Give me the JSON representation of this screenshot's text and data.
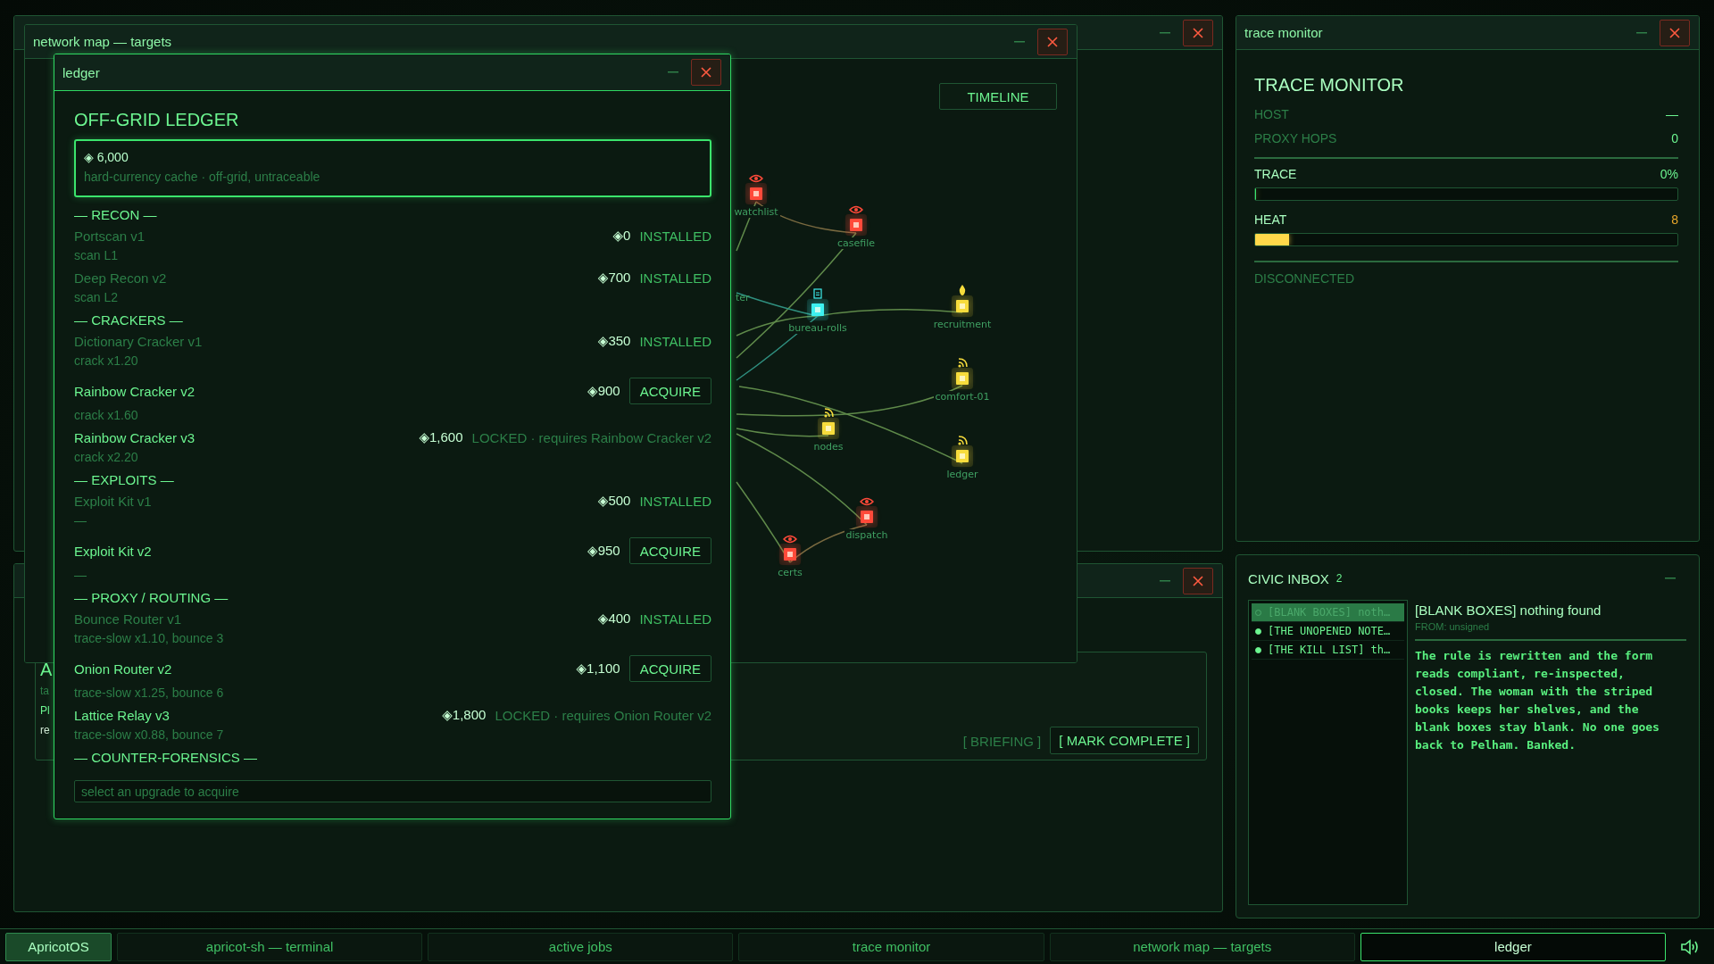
{
  "jobs_window": {
    "fragments": [
      "A",
      "ta",
      "Pl",
      "re"
    ],
    "actions": [
      {
        "label": "[ BRIEFING ]",
        "kind": "link"
      },
      {
        "label": "[ MARK COMPLETE ]",
        "kind": "button"
      }
    ]
  },
  "network_map": {
    "title": "network map — targets",
    "timeline_button": "TIMELINE",
    "cut_label": "ter",
    "nodes": [
      {
        "label": "watchlist",
        "kind": "watch",
        "color": "#ff4a3a"
      },
      {
        "label": "casefile",
        "kind": "watch",
        "color": "#ff4a3a"
      },
      {
        "label": "bureau-rolls",
        "kind": "file",
        "color": "#3ef0f0"
      },
      {
        "label": "recruitment",
        "kind": "flame",
        "color": "#f7dc3c"
      },
      {
        "label": "comfort-01",
        "kind": "signal",
        "color": "#f7dc3c"
      },
      {
        "label": "nodes",
        "kind": "signal",
        "color": "#f7dc3c"
      },
      {
        "label": "ledger",
        "kind": "signal",
        "color": "#f7dc3c"
      },
      {
        "label": "dispatch",
        "kind": "watch",
        "color": "#ff4a3a"
      },
      {
        "label": "certs",
        "kind": "watch",
        "color": "#ff4a3a"
      }
    ]
  },
  "ledger": {
    "title": "ledger",
    "heading": "OFF-GRID LEDGER",
    "balance": "◈ 6,000",
    "balance_note": "hard-currency cache · off-grid, untraceable",
    "sections": [
      {
        "title": "— RECON —",
        "items": [
          {
            "name": "Portscan v1",
            "detail": "scan L1",
            "price": "◈0",
            "kind": "installed",
            "status": "INSTALLED"
          },
          {
            "name": "Deep Recon v2",
            "detail": "scan L2",
            "price": "◈700",
            "kind": "installed",
            "status": "INSTALLED"
          }
        ]
      },
      {
        "title": "— CRACKERS —",
        "items": [
          {
            "name": "Dictionary Cracker v1",
            "detail": "crack x1.20",
            "price": "◈350",
            "kind": "installed",
            "status": "INSTALLED"
          },
          {
            "name": "Rainbow Cracker v2",
            "detail": "crack x1.60",
            "price": "◈900",
            "kind": "available",
            "status": "ACQUIRE"
          },
          {
            "name": "Rainbow Cracker v3",
            "detail": "crack x2.20",
            "price": "◈1,600",
            "kind": "locked",
            "status": "LOCKED · requires Rainbow Cracker v2"
          }
        ]
      },
      {
        "title": "— EXPLOITS —",
        "items": [
          {
            "name": "Exploit Kit v1",
            "detail": "—",
            "price": "◈500",
            "kind": "installed",
            "status": "INSTALLED"
          },
          {
            "name": "Exploit Kit v2",
            "detail": "—",
            "price": "◈950",
            "kind": "available",
            "status": "ACQUIRE"
          }
        ]
      },
      {
        "title": "— PROXY / ROUTING —",
        "items": [
          {
            "name": "Bounce Router v1",
            "detail": "trace-slow x1.10, bounce 3",
            "price": "◈400",
            "kind": "installed",
            "status": "INSTALLED"
          },
          {
            "name": "Onion Router v2",
            "detail": "trace-slow x1.25, bounce 6",
            "price": "◈1,100",
            "kind": "available",
            "status": "ACQUIRE"
          },
          {
            "name": "Lattice Relay v3",
            "detail": "trace-slow x0.88, bounce 7",
            "price": "◈1,800",
            "kind": "locked",
            "status": "LOCKED · requires Onion Router v2"
          }
        ]
      },
      {
        "title": "— COUNTER-FORENSICS —"
      }
    ],
    "status_field": {
      "placeholder": "select an upgrade to acquire"
    }
  },
  "trace_monitor": {
    "title": "trace monitor",
    "heading": "TRACE MONITOR",
    "stats": [
      {
        "label": "HOST",
        "value": "—"
      },
      {
        "label": "PROXY HOPS",
        "value": "0"
      }
    ],
    "meters": [
      {
        "label": "TRACE",
        "reading": "0%",
        "kind": "trace",
        "level": 0
      },
      {
        "label": "HEAT",
        "reading": "8",
        "kind": "heat",
        "level": 0.08
      }
    ],
    "status": "DISCONNECTED"
  },
  "inbox": {
    "title": "CIVIC INBOX",
    "count": "2",
    "messages": [
      {
        "subject": "[BLANK BOXES] noth…",
        "unread": false,
        "selected": true
      },
      {
        "subject": "[THE UNOPENED NOTE…",
        "unread": true,
        "selected": false
      },
      {
        "subject": "[THE KILL LIST] th…",
        "unread": true,
        "selected": false
      }
    ],
    "open_message": {
      "subject": "[BLANK BOXES] nothing found",
      "from": "FROM: unsigned",
      "body": "The rule is rewritten and the form reads compliant, re-inspected, closed. The woman with the striped books keeps her shelves, and the blank boxes stay blank. No one goes back to Pelham. Banked."
    }
  },
  "taskbar": {
    "start": "ApricotOS",
    "items": [
      {
        "label": "apricot-sh — terminal",
        "selected": false
      },
      {
        "label": "active jobs",
        "selected": false
      },
      {
        "label": "trace monitor",
        "selected": false
      },
      {
        "label": "network map — targets",
        "selected": false
      },
      {
        "label": "ledger",
        "selected": true
      }
    ]
  }
}
